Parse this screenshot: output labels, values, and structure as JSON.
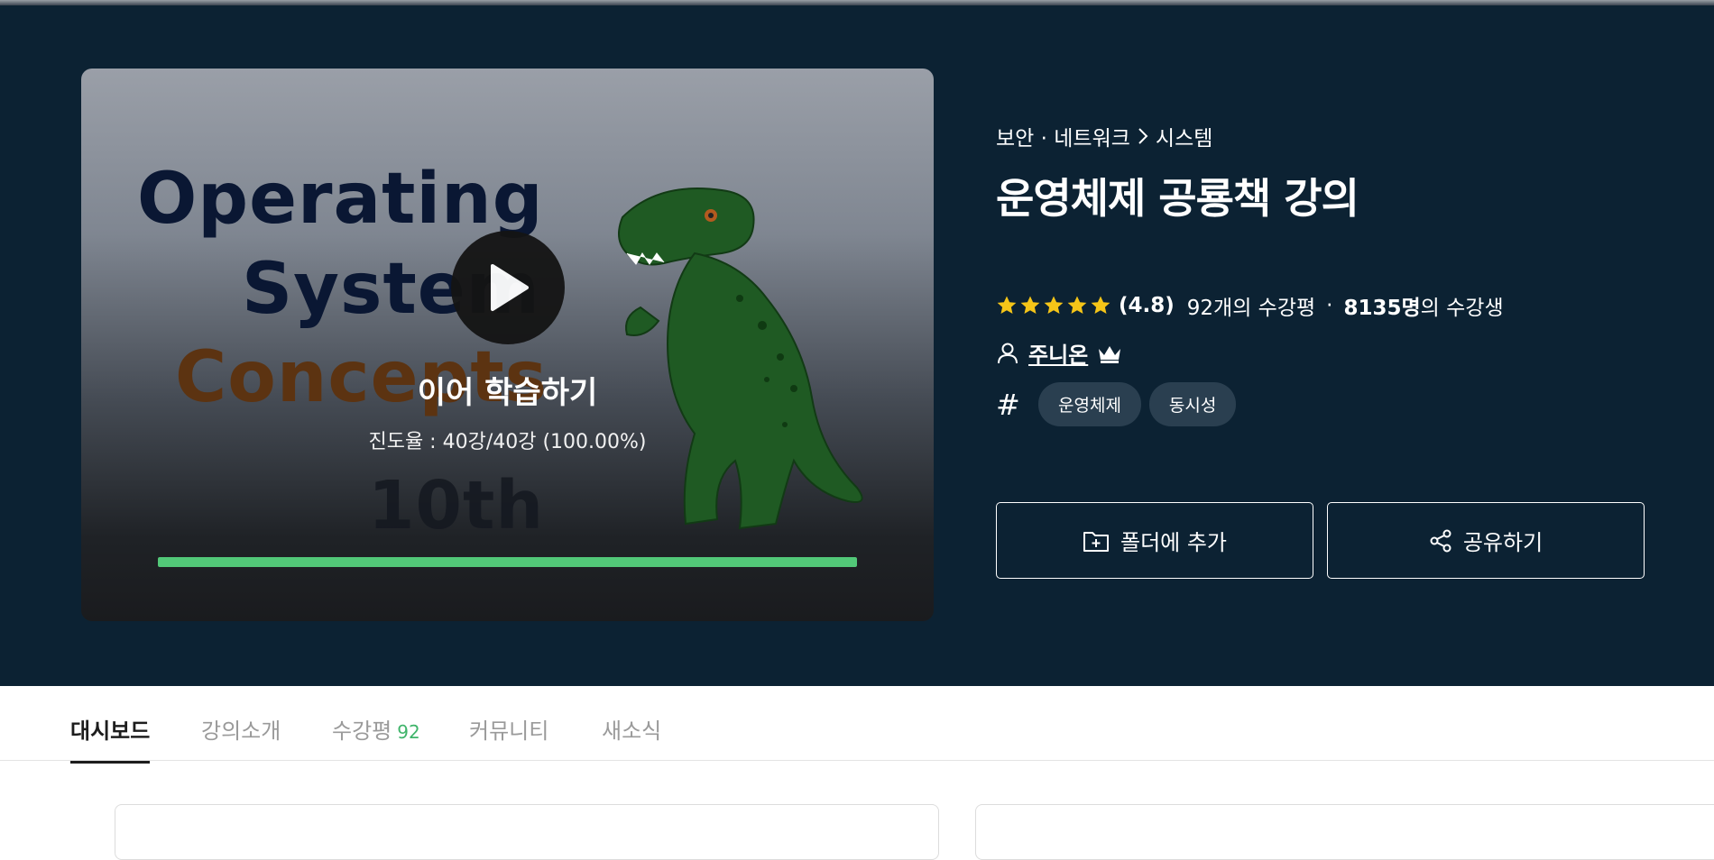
{
  "cover": {
    "lines": [
      "Operating",
      "System",
      "Concepts",
      "10th"
    ]
  },
  "player": {
    "resume_label": "이어 학습하기",
    "progress_text": "진도율 : 40강/40강 (100.00%)",
    "progress_fraction": 1.0
  },
  "course": {
    "breadcrumb": [
      "보안 · 네트워크",
      "시스템"
    ],
    "title": "운영체제 공룡책 강의",
    "rating": {
      "score": "(4.8)",
      "stars": 5,
      "review_count": "92개의 수강평",
      "students_bold": "8135명",
      "students_suffix": "의 수강생"
    },
    "instructor": "주니온",
    "tags": [
      "운영체제",
      "동시성"
    ]
  },
  "actions": {
    "folder_label": "폴더에 추가",
    "share_label": "공유하기"
  },
  "tabs": [
    {
      "label": "대시보드",
      "active": true
    },
    {
      "label": "강의소개"
    },
    {
      "label": "수강평",
      "count": "92"
    },
    {
      "label": "커뮤니티"
    },
    {
      "label": "새소식"
    }
  ],
  "colors": {
    "hero_bg": "#0c2233",
    "progress": "#52c878",
    "star": "#f5c518",
    "tag_bg": "#2a3f50"
  }
}
